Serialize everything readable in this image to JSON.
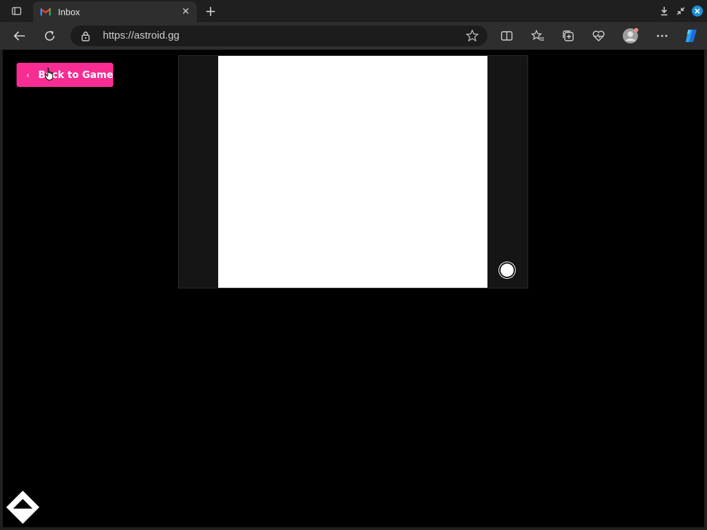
{
  "browser": {
    "tab": {
      "title": "Inbox",
      "favicon": "gmail-icon"
    },
    "address_bar": {
      "url": "https://astroid.gg"
    },
    "colors": {
      "accent_blue": "#1e8fd8"
    }
  },
  "page": {
    "back_button": {
      "label": "Back to Game",
      "chevron": "‹",
      "color": "#f72d94"
    },
    "logo": "astroid-logo-icon"
  }
}
